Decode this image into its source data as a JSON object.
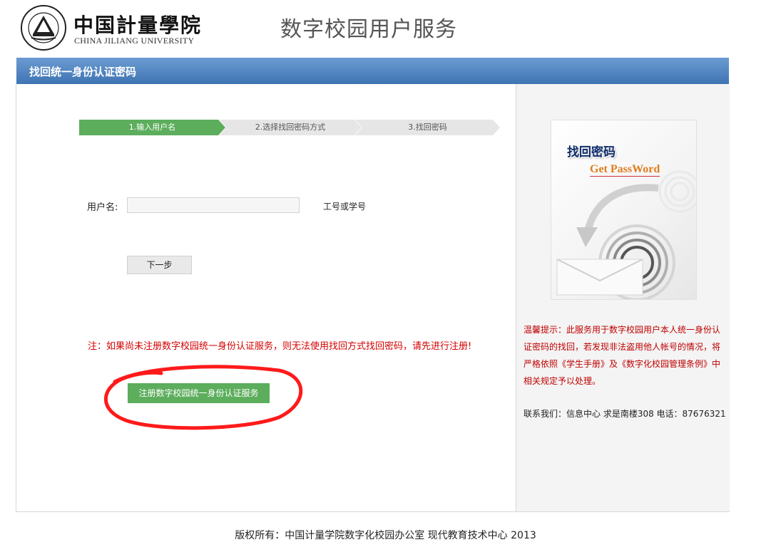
{
  "header": {
    "logo_name": "中国計量學院",
    "logo_english": "CHINA JILIANG UNIVERSITY",
    "site_title": "数字校园用户服务"
  },
  "title_bar": {
    "label": "找回统一身份认证密码"
  },
  "steps": [
    {
      "label": "1.输入用户名",
      "active": true
    },
    {
      "label": "2.选择找回密码方式",
      "active": false
    },
    {
      "label": "3.找回密码",
      "active": false
    }
  ],
  "form": {
    "username_label": "用户名:",
    "username_value": "",
    "username_hint": "工号或学号",
    "next_button": "下一步"
  },
  "note": {
    "text": "注：如果尚未注册数字校园统一身份认证服务，则无法使用找回方式找回密码，请先进行注册!",
    "register_button": "注册数字校园统一身份认证服务"
  },
  "sidebar": {
    "card_title": "找回密码",
    "card_subtitle": "Get PassWord",
    "tip": "温馨提示：此服务用于数字校园用户本人统一身份认证密码的找回，若发现非法盗用他人帐号的情况，将严格依照《学生手册》及《数字化校园管理条例》中相关规定予以处理。",
    "contact": "联系我们：信息中心 求是南楼308 电话：87676321"
  },
  "footer": {
    "text": "版权所有：中国计量学院数字化校园办公室 现代教育技术中心 2013"
  },
  "colors": {
    "bar": "#3f74b3",
    "step_active": "#5cad5c",
    "step_inactive": "#e6e6e6",
    "warning": "#d40000",
    "annotation": "#ff0000"
  }
}
